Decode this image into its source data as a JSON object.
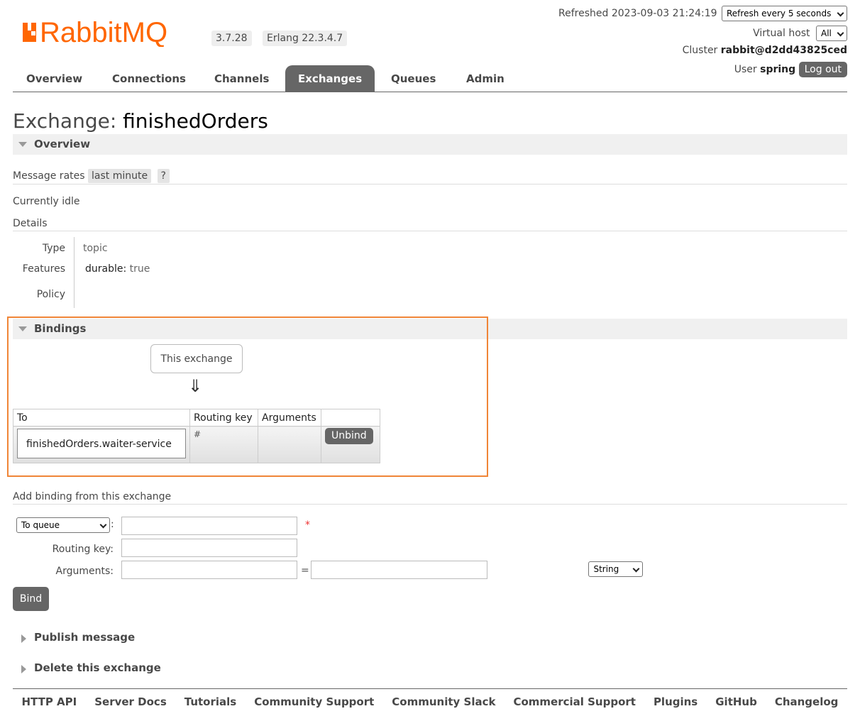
{
  "header": {
    "logo_text": "RabbitMQ",
    "version": "3.7.28",
    "erlang": "Erlang 22.3.4.7",
    "refreshed": "Refreshed 2023-09-03 21:24:19",
    "refresh_select": "Refresh every 5 seconds",
    "vhost_label": "Virtual host",
    "vhost_select": "All",
    "cluster_label": "Cluster",
    "cluster_name": "rabbit@d2dd43825ced",
    "user_label": "User",
    "user_name": "spring",
    "logout_label": "Log out"
  },
  "tabs": [
    {
      "label": "Overview"
    },
    {
      "label": "Connections"
    },
    {
      "label": "Channels"
    },
    {
      "label": "Exchanges",
      "active": true
    },
    {
      "label": "Queues"
    },
    {
      "label": "Admin"
    }
  ],
  "title": {
    "prefix": "Exchange:",
    "name": "finishedOrders"
  },
  "overview": {
    "section_label": "Overview",
    "message_rates_label": "Message rates",
    "rates_period": "last minute",
    "help": "?",
    "status": "Currently idle",
    "details_label": "Details",
    "details": {
      "type_key": "Type",
      "type_val": "topic",
      "features_key": "Features",
      "features_name": "durable:",
      "features_val": "true",
      "policy_key": "Policy"
    }
  },
  "bindings": {
    "section_label": "Bindings",
    "this_exchange": "This exchange",
    "arrow": "⇓",
    "columns": [
      "To",
      "Routing key",
      "Arguments",
      ""
    ],
    "rows": [
      {
        "to": "finishedOrders.waiter-service",
        "routing_key": "#",
        "arguments": "",
        "action": "Unbind"
      }
    ]
  },
  "add_binding": {
    "heading": "Add binding from this exchange",
    "dest_select": "To queue",
    "colon": ":",
    "required": "*",
    "routing_key_label": "Routing key:",
    "arguments_label": "Arguments:",
    "equals": "=",
    "type_select": "String",
    "bind_button": "Bind"
  },
  "collapsed_sections": {
    "publish": "Publish message",
    "delete": "Delete this exchange"
  },
  "footer": [
    "HTTP API",
    "Server Docs",
    "Tutorials",
    "Community Support",
    "Community Slack",
    "Commercial Support",
    "Plugins",
    "GitHub",
    "Changelog"
  ],
  "colors": {
    "accent": "#f60",
    "dark": "#666666",
    "highlight": "#f08537"
  }
}
